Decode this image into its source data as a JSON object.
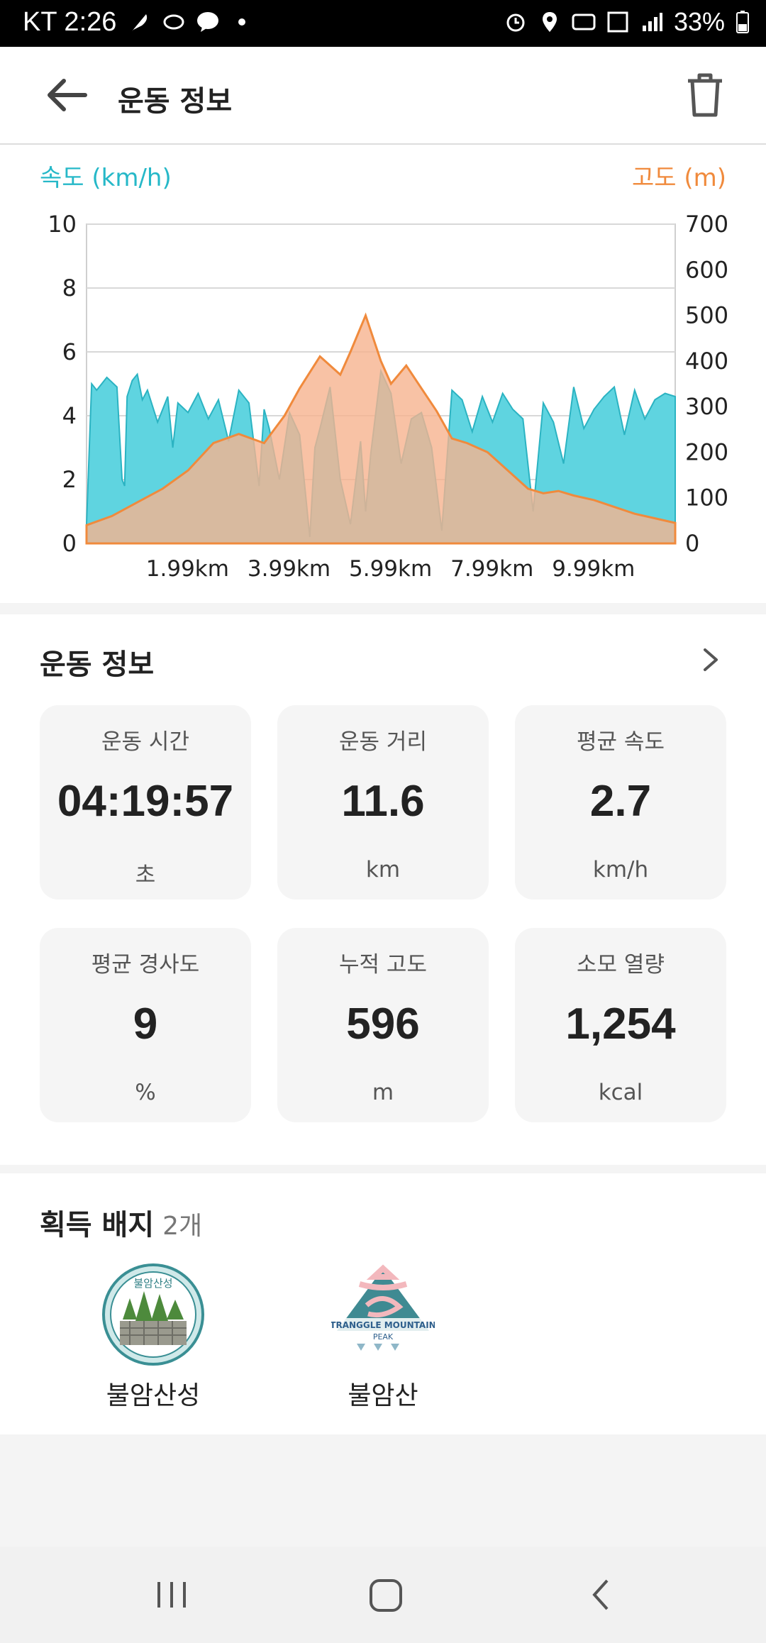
{
  "status_bar": {
    "carrier_time": "KT 2:26",
    "battery": "33%"
  },
  "header": {
    "title": "운동 정보"
  },
  "chart": {
    "left_axis_label": "속도 (km/h)",
    "right_axis_label": "고도 (m)",
    "left_color": "#26b8c8",
    "right_color": "#f08a3c"
  },
  "chart_data": {
    "type": "area",
    "xlabel": "",
    "x_tick_labels": [
      "1.99km",
      "3.99km",
      "5.99km",
      "7.99km",
      "9.99km"
    ],
    "x_ticks_km": [
      1.99,
      3.99,
      5.99,
      7.99,
      9.99
    ],
    "xlim": [
      0,
      11.6
    ],
    "y_left": {
      "label": "속도 (km/h)",
      "ylim": [
        0,
        10
      ],
      "ticks": [
        0,
        2,
        4,
        6,
        8,
        10
      ]
    },
    "y_right": {
      "label": "고도 (m)",
      "ylim": [
        0,
        700
      ],
      "ticks": [
        0,
        100,
        200,
        300,
        400,
        500,
        600,
        700
      ]
    },
    "grid": true,
    "series": [
      {
        "name": "속도 (km/h)",
        "axis": "left",
        "color": "#5fd4e0",
        "x": [
          0,
          0.1,
          0.2,
          0.4,
          0.6,
          0.7,
          0.75,
          0.8,
          0.9,
          1.0,
          1.1,
          1.2,
          1.4,
          1.6,
          1.7,
          1.8,
          2.0,
          2.2,
          2.4,
          2.6,
          2.8,
          3.0,
          3.2,
          3.4,
          3.5,
          3.6,
          3.8,
          4.0,
          4.2,
          4.4,
          4.5,
          4.6,
          4.8,
          5.0,
          5.2,
          5.4,
          5.5,
          5.6,
          5.8,
          6.0,
          6.2,
          6.4,
          6.6,
          6.8,
          7.0,
          7.2,
          7.4,
          7.6,
          7.8,
          8.0,
          8.2,
          8.4,
          8.6,
          8.8,
          9.0,
          9.2,
          9.4,
          9.6,
          9.8,
          10.0,
          10.2,
          10.4,
          10.6,
          10.8,
          11.0,
          11.2,
          11.4,
          11.6
        ],
        "values": [
          0.6,
          5.0,
          4.8,
          5.2,
          4.9,
          2.0,
          1.8,
          4.6,
          5.1,
          5.3,
          4.5,
          4.8,
          3.8,
          4.6,
          3.0,
          4.4,
          4.1,
          4.7,
          3.9,
          4.5,
          3.2,
          4.8,
          4.4,
          1.8,
          4.2,
          3.6,
          2.0,
          4.1,
          3.4,
          0.2,
          3.0,
          3.6,
          4.9,
          2.0,
          0.6,
          3.2,
          1.0,
          2.8,
          5.4,
          4.7,
          2.5,
          3.9,
          4.1,
          3.0,
          0.4,
          4.8,
          4.5,
          3.5,
          4.6,
          3.8,
          4.7,
          4.2,
          3.9,
          1.0,
          4.4,
          3.8,
          2.5,
          4.9,
          3.6,
          4.2,
          4.6,
          4.9,
          3.4,
          4.8,
          3.9,
          4.5,
          4.7,
          4.6
        ]
      },
      {
        "name": "고도 (m)",
        "axis": "right",
        "color": "#f6b38e",
        "x": [
          0,
          0.5,
          1.0,
          1.5,
          2.0,
          2.5,
          3.0,
          3.5,
          3.9,
          4.2,
          4.6,
          5.0,
          5.2,
          5.5,
          5.8,
          6.0,
          6.3,
          6.6,
          6.9,
          7.2,
          7.5,
          7.9,
          8.3,
          8.7,
          9.0,
          9.3,
          9.6,
          10.0,
          10.4,
          10.8,
          11.2,
          11.6
        ],
        "values": [
          40,
          60,
          90,
          120,
          160,
          220,
          240,
          220,
          280,
          340,
          410,
          370,
          420,
          500,
          400,
          350,
          390,
          340,
          290,
          230,
          220,
          200,
          160,
          120,
          110,
          115,
          105,
          95,
          80,
          65,
          55,
          45
        ]
      }
    ]
  },
  "workout_info": {
    "title": "운동 정보",
    "cards": [
      {
        "label": "운동 시간",
        "value": "04:19:57",
        "unit": "초"
      },
      {
        "label": "운동 거리",
        "value": "11.6",
        "unit": "km"
      },
      {
        "label": "평균 속도",
        "value": "2.7",
        "unit": "km/h"
      },
      {
        "label": "평균 경사도",
        "value": "9",
        "unit": "%"
      },
      {
        "label": "누적 고도",
        "value": "596",
        "unit": "m"
      },
      {
        "label": "소모 열량",
        "value": "1,254",
        "unit": "kcal"
      }
    ]
  },
  "badges": {
    "title": "획득 배지",
    "count": "2개",
    "items": [
      {
        "name": "불암산성",
        "emblem_text": "불암산성",
        "icon": "fortress-badge-icon"
      },
      {
        "name": "불암산",
        "emblem_text_1": "TRANGGLE MOUNTAIN",
        "emblem_text_2": "PEAK",
        "icon": "mountain-peak-badge-icon"
      }
    ]
  }
}
